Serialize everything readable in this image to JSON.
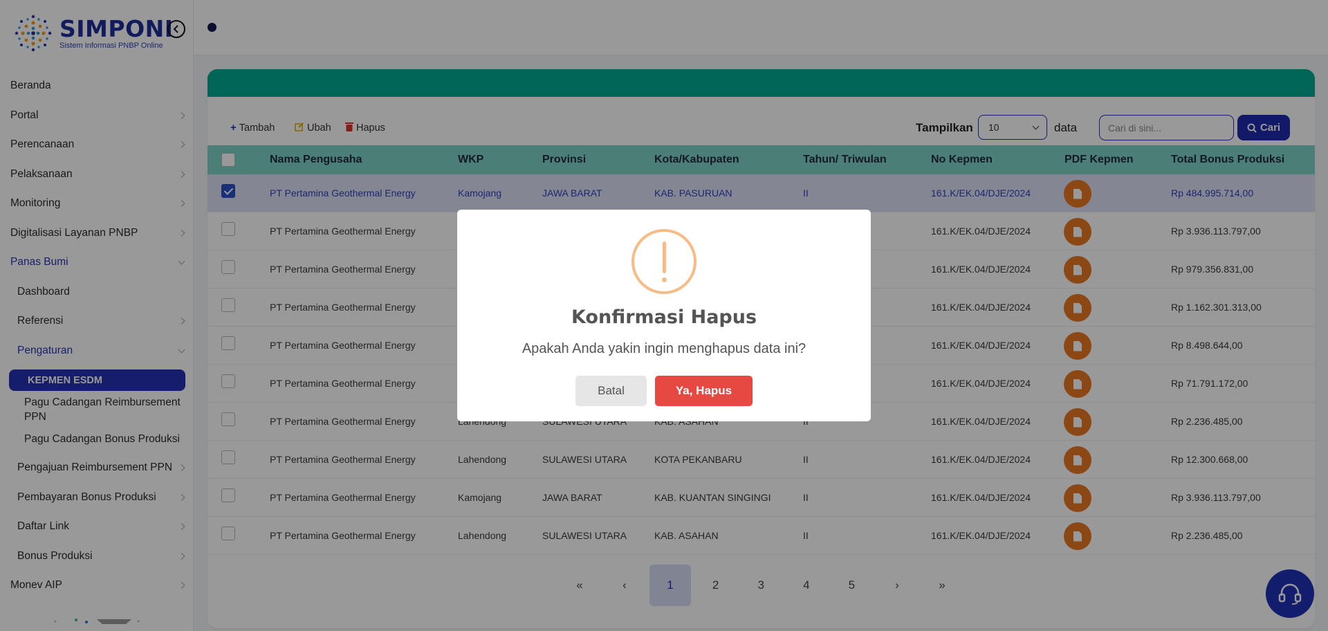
{
  "brand": {
    "name": "SIMPONI",
    "tagline": "Sistem Informasi PNBP Online"
  },
  "menu": [
    {
      "label": "Beranda",
      "chevron": false,
      "level": "top"
    },
    {
      "label": "Portal",
      "chevron": "right",
      "level": "top"
    },
    {
      "label": "Perencanaan",
      "chevron": "right",
      "level": "top"
    },
    {
      "label": "Pelaksanaan",
      "chevron": "right",
      "level": "top"
    },
    {
      "label": "Monitoring",
      "chevron": "right",
      "level": "top"
    },
    {
      "label": "Digitalisasi Layanan PNBP",
      "chevron": "right",
      "level": "top"
    },
    {
      "label": "Panas Bumi",
      "chevron": "down",
      "level": "top",
      "active": true
    },
    {
      "label": "Dashboard",
      "chevron": false,
      "level": "sub"
    },
    {
      "label": "Referensi",
      "chevron": "right",
      "level": "sub"
    },
    {
      "label": "Pengaturan",
      "chevron": "down",
      "level": "sub",
      "active": true
    },
    {
      "label": "KEPMEN ESDM",
      "chevron": false,
      "level": "pill"
    },
    {
      "label": "Pagu Cadangan Reimbursement PPN",
      "chevron": false,
      "level": "leaf"
    },
    {
      "label": "Pagu Cadangan Bonus Produksi",
      "chevron": false,
      "level": "leaf"
    },
    {
      "label": "Pengajuan Reimbursement PPN",
      "chevron": "right",
      "level": "sub"
    },
    {
      "label": "Pembayaran Bonus Produksi",
      "chevron": "right",
      "level": "sub"
    },
    {
      "label": "Daftar Link",
      "chevron": "right",
      "level": "sub"
    },
    {
      "label": "Bonus Produksi",
      "chevron": "right",
      "level": "sub"
    },
    {
      "label": "Monev AIP",
      "chevron": "right",
      "level": "top"
    }
  ],
  "toolbar": {
    "add_label": "Tambah",
    "edit_label": "Ubah",
    "delete_label": "Hapus",
    "show_label": "Tampilkan",
    "page_size": "10",
    "data_label": "data",
    "search_placeholder": "Cari di sini...",
    "search_button": "Cari"
  },
  "table": {
    "columns": [
      "Nama Pengusaha",
      "WKP",
      "Provinsi",
      "Kota/Kabupaten",
      "Tahun/ Triwulan",
      "No Kepmen",
      "PDF Kepmen",
      "Total Bonus Produksi"
    ],
    "rows": [
      {
        "checked": true,
        "nama": "PT Pertamina Geothermal Energy",
        "wkp": "Kamojang",
        "provinsi": "JAWA BARAT",
        "kota": "KAB. PASURUAN",
        "tahun": "II",
        "kepmen": "161.K/EK.04/DJE/2024",
        "total": "Rp 484.995.714,00"
      },
      {
        "checked": false,
        "nama": "PT Pertamina Geothermal Energy",
        "wkp": "",
        "provinsi": "",
        "kota": "",
        "tahun": "",
        "kepmen": "161.K/EK.04/DJE/2024",
        "total": "Rp 3.936.113.797,00"
      },
      {
        "checked": false,
        "nama": "PT Pertamina Geothermal Energy",
        "wkp": "",
        "provinsi": "",
        "kota": "",
        "tahun": "",
        "kepmen": "161.K/EK.04/DJE/2024",
        "total": "Rp 979.356.831,00"
      },
      {
        "checked": false,
        "nama": "PT Pertamina Geothermal Energy",
        "wkp": "",
        "provinsi": "",
        "kota": "",
        "tahun": "",
        "kepmen": "161.K/EK.04/DJE/2024",
        "total": "Rp 1.162.301.313,00"
      },
      {
        "checked": false,
        "nama": "PT Pertamina Geothermal Energy",
        "wkp": "",
        "provinsi": "",
        "kota": "",
        "tahun": "",
        "kepmen": "161.K/EK.04/DJE/2024",
        "total": "Rp 8.498.644,00"
      },
      {
        "checked": false,
        "nama": "PT Pertamina Geothermal Energy",
        "wkp": "",
        "provinsi": "",
        "kota": "",
        "tahun": "",
        "kepmen": "161.K/EK.04/DJE/2024",
        "total": "Rp 71.791.172,00"
      },
      {
        "checked": false,
        "nama": "PT Pertamina Geothermal Energy",
        "wkp": "Lahendong",
        "provinsi": "SULAWESI UTARA",
        "kota": "KAB. ASAHAN",
        "tahun": "II",
        "kepmen": "161.K/EK.04/DJE/2024",
        "total": "Rp 2.236.485,00"
      },
      {
        "checked": false,
        "nama": "PT Pertamina Geothermal Energy",
        "wkp": "Lahendong",
        "provinsi": "SULAWESI UTARA",
        "kota": "KOTA PEKANBARU",
        "tahun": "II",
        "kepmen": "161.K/EK.04/DJE/2024",
        "total": "Rp 12.300.668,00"
      },
      {
        "checked": false,
        "nama": "PT Pertamina Geothermal Energy",
        "wkp": "Kamojang",
        "provinsi": "JAWA BARAT",
        "kota": "KAB. KUANTAN SINGINGI",
        "tahun": "II",
        "kepmen": "161.K/EK.04/DJE/2024",
        "total": "Rp 3.936.113.797,00"
      },
      {
        "checked": false,
        "nama": "PT Pertamina Geothermal Energy",
        "wkp": "Lahendong",
        "provinsi": "SULAWESI UTARA",
        "kota": "KAB. ASAHAN",
        "tahun": "II",
        "kepmen": "161.K/EK.04/DJE/2024",
        "total": "Rp 2.236.485,00"
      }
    ]
  },
  "pagination": {
    "first": "«",
    "prev": "‹",
    "next": "›",
    "last": "»",
    "pages": [
      "1",
      "2",
      "3",
      "4",
      "5"
    ],
    "current": "1"
  },
  "modal": {
    "title": "Konfirmasi Hapus",
    "message": "Apakah Anda yakin ingin menghapus data ini?",
    "cancel": "Batal",
    "confirm": "Ya, Hapus"
  },
  "colors": {
    "brand_blue": "#2633b5",
    "teal_band": "#00a98f",
    "header_teal": "#7fd3c8",
    "pdf_orange": "#e87722",
    "warning": "#f8bb86",
    "danger": "#e64942"
  },
  "icons": {
    "add": "plus-icon",
    "edit": "edit-icon",
    "delete": "trash-icon",
    "search": "search-icon",
    "pdf": "file-icon",
    "help": "headset-icon",
    "collapse": "chevron-left-icon",
    "warning": "exclamation-icon"
  }
}
